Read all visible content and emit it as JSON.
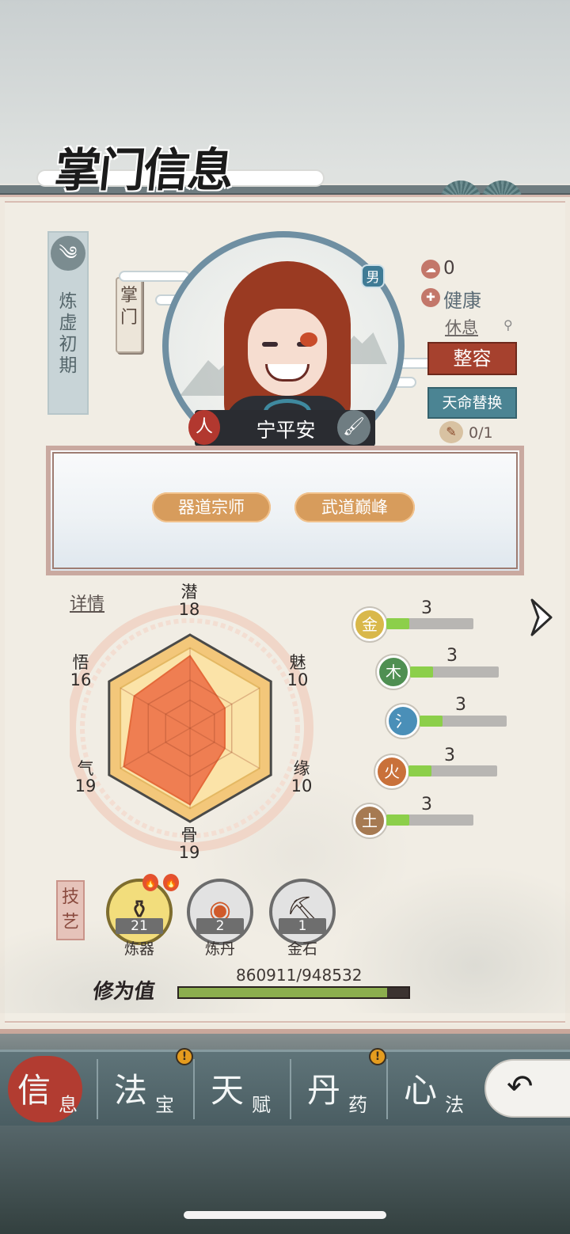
{
  "header": {
    "title": "掌门信息"
  },
  "character": {
    "realm": "炼虚初期",
    "role": "掌门",
    "gender": "男",
    "name": "宁平安",
    "race_badge": "人",
    "brush_badge": "🖌",
    "fame": "0",
    "health": "健康",
    "action": "休息",
    "makeover_label": "整容",
    "fate_swap_label": "天命替换",
    "fate_swap_count": "0/1"
  },
  "traits": [
    "器道宗师",
    "武道巅峰"
  ],
  "attributes": {
    "detail_link": "详情",
    "items": [
      {
        "label": "潜",
        "value": "18"
      },
      {
        "label": "魅",
        "value": "10"
      },
      {
        "label": "缘",
        "value": "10"
      },
      {
        "label": "骨",
        "value": "19"
      },
      {
        "label": "气",
        "value": "19"
      },
      {
        "label": "悟",
        "value": "16"
      }
    ],
    "max": 20
  },
  "elements": [
    {
      "name": "金",
      "glyph": "金",
      "value": "3",
      "fraction": 0.26,
      "color": "#d9b84a"
    },
    {
      "name": "木",
      "glyph": "木",
      "value": "3",
      "fraction": 0.26,
      "color": "#4f8f52"
    },
    {
      "name": "水",
      "glyph": "氵",
      "value": "3",
      "fraction": 0.26,
      "color": "#4a8fb8"
    },
    {
      "name": "火",
      "glyph": "火",
      "value": "3",
      "fraction": 0.26,
      "color": "#c9713a"
    },
    {
      "name": "土",
      "glyph": "土",
      "value": "3",
      "fraction": 0.26,
      "color": "#a67a52"
    }
  ],
  "skills": {
    "section_label": "技艺",
    "items": [
      {
        "name": "炼器",
        "level": "21",
        "glyph": "⚱",
        "highlighted": true
      },
      {
        "name": "炼丹",
        "level": "2",
        "glyph": "◉",
        "highlighted": false
      },
      {
        "name": "金石",
        "level": "1",
        "glyph": "⛏",
        "highlighted": false
      }
    ]
  },
  "cultivation": {
    "label": "修为值",
    "value_text": "860911/948532",
    "fraction": 0.9076
  },
  "tabs": [
    {
      "main": "信",
      "sub": "息",
      "active": true,
      "alert": false
    },
    {
      "main": "法",
      "sub": "宝",
      "active": false,
      "alert": true
    },
    {
      "main": "天",
      "sub": "赋",
      "active": false,
      "alert": false
    },
    {
      "main": "丹",
      "sub": "药",
      "active": false,
      "alert": true
    },
    {
      "main": "心",
      "sub": "法",
      "active": false,
      "alert": false
    }
  ],
  "alert_glyph": "!",
  "back_glyph": "↶",
  "next_glyph": "›",
  "colors": {
    "accent_red": "#a6412e",
    "accent_teal": "#4b8493",
    "radar_fill": "#ef7e52",
    "radar_frame": "#f3c77a",
    "element_fill": "#8ccf4a",
    "cultivation_fill": "#8cae4e"
  }
}
